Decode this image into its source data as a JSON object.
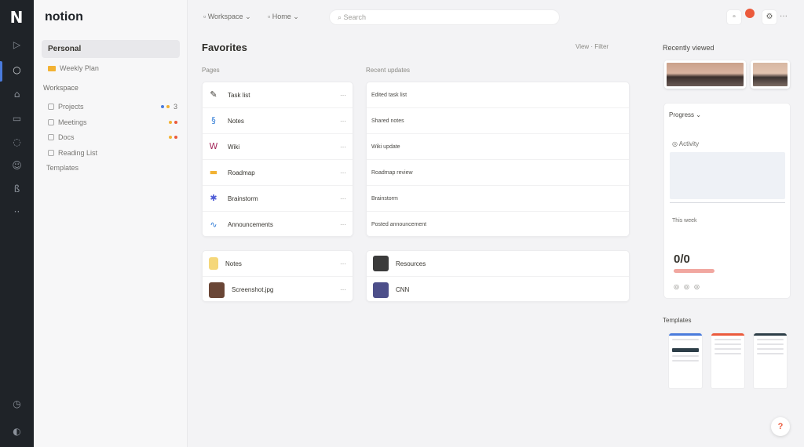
{
  "app": {
    "logo": "N",
    "name": "notion"
  },
  "rail": {
    "icons": [
      "page-icon",
      "home-icon",
      "inbox-icon",
      "calendar-icon",
      "chat-icon",
      "people-icon",
      "settings-icon",
      "more-icon",
      "clock-icon",
      "account-icon"
    ],
    "glyphs": [
      "▷",
      "○",
      "⌂",
      "▭",
      "◌",
      "☺",
      "ß",
      "··",
      "◷",
      "◐"
    ]
  },
  "sidebar": {
    "active_item": "Personal",
    "starred_item": "Weekly Plan",
    "section_heading": "Workspace",
    "items": [
      {
        "label": "Projects",
        "dots": [
          "#4a7bdc",
          "#f2b233"
        ],
        "count": "3"
      },
      {
        "label": "Meetings",
        "dots": [
          "#f2b233",
          "#eb5a3c"
        ],
        "count": ""
      },
      {
        "label": "Docs",
        "dots": [
          "#f2b233",
          "#eb5a3c"
        ],
        "count": ""
      },
      {
        "label": "Reading List",
        "dots": [],
        "count": ""
      }
    ],
    "footer_item": "Templates"
  },
  "topbar": {
    "crumb_1": "Workspace",
    "crumb_2": "Home",
    "search_placeholder": "Search"
  },
  "main": {
    "title": "Favorites",
    "actions": "View · Filter",
    "col_left_head": "Pages",
    "col_right_head": "Recent updates",
    "pages": [
      {
        "icon": "✎",
        "color": "#37352f",
        "label": "Task list"
      },
      {
        "icon": "§",
        "color": "#2f7bd6",
        "label": "Notes"
      },
      {
        "icon": "W",
        "color": "#a4285b",
        "label": "Wiki"
      },
      {
        "icon": "▬",
        "color": "#f2b233",
        "label": "Roadmap"
      },
      {
        "icon": "✱",
        "color": "#4d5bd6",
        "label": "Brainstorm"
      },
      {
        "icon": "∿",
        "color": "#2f7bd6",
        "label": "Announcements"
      }
    ],
    "previews": [
      {
        "line1": "Edited task list",
        "line2": ""
      },
      {
        "line1": "Shared notes",
        "line2": ""
      },
      {
        "line1": "Wiki update",
        "line2": ""
      },
      {
        "line1": "Roadmap review",
        "line2": ""
      },
      {
        "line1": "Brainstorm",
        "line2": ""
      },
      {
        "line1": "Posted announcement",
        "line2": ""
      }
    ],
    "files_left": [
      {
        "label": "Notes",
        "thumb": "#f5d77a"
      },
      {
        "label": "Screenshot.jpg",
        "thumb": "#6a4636"
      }
    ],
    "files_right": [
      {
        "label": "Resources",
        "thumb": "#3b3b3b"
      },
      {
        "label": "CNN",
        "thumb": "#4d4f8a"
      }
    ]
  },
  "right_panel": {
    "heading": "Recently viewed",
    "card_title": "Progress",
    "chart_label": "Activity",
    "chart_sub": "This week",
    "big_value": "0/0",
    "controls": "◎◎◎",
    "sub_heading": "Templates",
    "template_colors": [
      "#4a7bdc",
      "#eb5a3c",
      "#2d3e48"
    ]
  },
  "help": {
    "label": "?"
  },
  "colors": {
    "accent": "#4a7bdc",
    "alert": "#eb5a3c",
    "rail": "#1f2328"
  }
}
